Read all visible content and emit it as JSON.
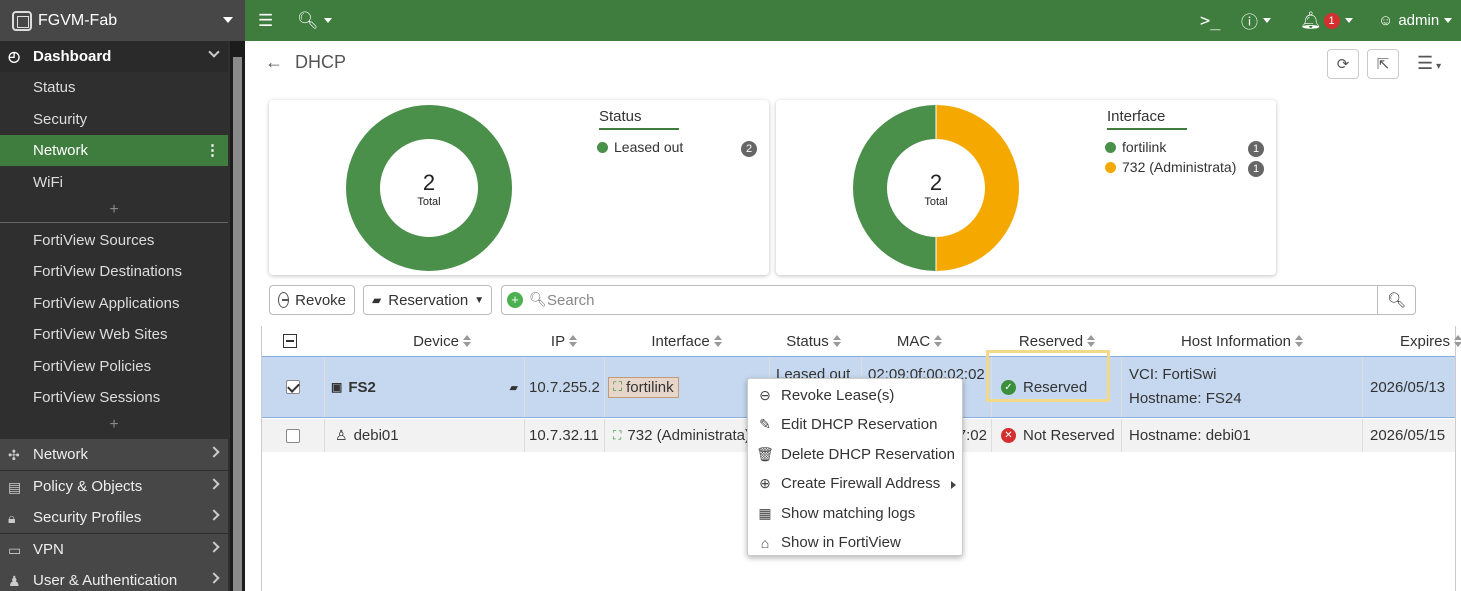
{
  "app": {
    "title": "FGVM-Fab"
  },
  "topbar": {
    "notif_count": "1",
    "user": "admin"
  },
  "sidebar": {
    "dashboard": "Dashboard",
    "dash_items": [
      "Status",
      "Security",
      "Network",
      "WiFi"
    ],
    "fortiview": [
      "FortiView Sources",
      "FortiView Destinations",
      "FortiView Applications",
      "FortiView Web Sites",
      "FortiView Policies",
      "FortiView Sessions"
    ],
    "nav": [
      "Network",
      "Policy & Objects",
      "Security Profiles",
      "VPN",
      "User & Authentication"
    ]
  },
  "page": {
    "title": "DHCP"
  },
  "status_card": {
    "total": "2",
    "total_label": "Total",
    "legend_title": "Status",
    "items": [
      {
        "label": "Leased out",
        "count": "2",
        "color": "#4a8f4a"
      }
    ]
  },
  "interface_card": {
    "total": "2",
    "total_label": "Total",
    "legend_title": "Interface",
    "items": [
      {
        "label": "fortilink",
        "count": "1",
        "color": "#4a8f4a"
      },
      {
        "label": "732 (Administrata)",
        "count": "1",
        "color": "#f5a800"
      }
    ]
  },
  "toolbar": {
    "revoke": "Revoke",
    "reservation": "Reservation",
    "search_placeholder": "Search"
  },
  "table": {
    "columns": [
      "Device",
      "IP",
      "Interface",
      "Status",
      "MAC",
      "Reserved",
      "Host Information",
      "Expires"
    ],
    "rows": [
      {
        "device": "FS2",
        "ip": "10.7.255.2",
        "interface": "fortilink",
        "status": "Leased out",
        "mac": "02:09:0f:00:02:02",
        "reserved": "Reserved",
        "host_vci": "VCI: FortiSwi",
        "host_name": "Hostname: FS24",
        "expires": "2026/05/13"
      },
      {
        "device": "debi01",
        "ip": "10.7.32.11",
        "interface": "732 (Administrata)",
        "mac": "7:02",
        "reserved": "Not Reserved",
        "host_name": "Hostname: debi01",
        "expires": "2026/05/15"
      }
    ]
  },
  "context_menu": [
    "Revoke Lease(s)",
    "Edit DHCP Reservation",
    "Delete DHCP Reservation",
    "Create Firewall Address",
    "Show matching logs",
    "Show in FortiView"
  ]
}
